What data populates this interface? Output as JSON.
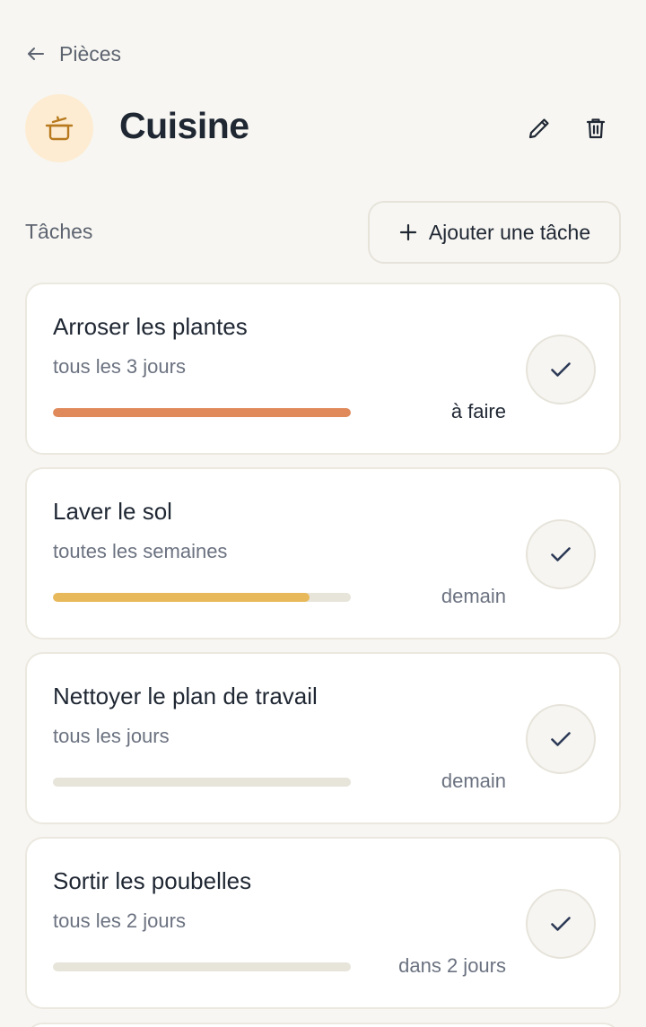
{
  "nav": {
    "back_label": "Pièces"
  },
  "room": {
    "title": "Cuisine",
    "icon": "cooking-pot-icon",
    "icon_bg": "#fdecd2",
    "icon_color": "#b87a1e"
  },
  "section": {
    "label": "Tâches",
    "add_label": "Ajouter une tâche"
  },
  "tasks": [
    {
      "name": "Arroser les plantes",
      "frequency": "tous les 3 jours",
      "due": "à faire",
      "progress": 1.0,
      "bar_color": "#e08a5b",
      "urgent": true
    },
    {
      "name": "Laver le sol",
      "frequency": "toutes les semaines",
      "due": "demain",
      "progress": 0.86,
      "bar_color": "#e8b95a",
      "urgent": false
    },
    {
      "name": "Nettoyer le plan de travail",
      "frequency": "tous les jours",
      "due": "demain",
      "progress": 0.0,
      "bar_color": "#e8b95a",
      "urgent": false
    },
    {
      "name": "Sortir les poubelles",
      "frequency": "tous les 2 jours",
      "due": "dans 2 jours",
      "progress": 0.0,
      "bar_color": "#e8b95a",
      "urgent": false
    }
  ],
  "colors": {
    "background": "#f7f6f2",
    "text": "#1f2733",
    "muted": "#6b7280",
    "check": "#2d3a57"
  }
}
